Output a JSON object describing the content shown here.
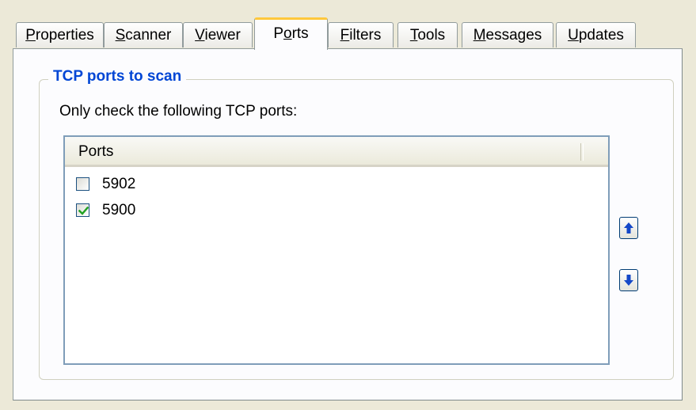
{
  "tabs": [
    {
      "label": "Properties",
      "accel": "P",
      "rest": "roperties"
    },
    {
      "label": "Scanner",
      "accel": "S",
      "rest": "canner"
    },
    {
      "label": "Viewer",
      "accel": "V",
      "rest": "iewer"
    },
    {
      "label": "Ports",
      "pre": "P",
      "accel": "o",
      "rest": "rts",
      "active": true
    },
    {
      "label": "Filters",
      "accel": "F",
      "rest": "ilters"
    },
    {
      "label": "Tools",
      "accel": "T",
      "rest": "ools"
    },
    {
      "label": "Messages",
      "accel": "M",
      "rest": "essages"
    },
    {
      "label": "Updates",
      "accel": "U",
      "rest": "pdates"
    }
  ],
  "group": {
    "title": "TCP ports to scan",
    "description": "Only check the following TCP ports:"
  },
  "list": {
    "column_header": "Ports",
    "items": [
      {
        "label": "5902",
        "checked": false
      },
      {
        "label": "5900",
        "checked": true
      }
    ]
  },
  "buttons": {
    "move_up_icon": "arrow-up-icon",
    "move_down_icon": "arrow-down-icon"
  },
  "colors": {
    "window_bg": "#ece9d8",
    "panel_bg": "#fcfcfe",
    "group_title": "#0046d5",
    "active_tab_accent": "#ffc83c",
    "check_green": "#21a121",
    "arrow_blue": "#1448c8"
  }
}
